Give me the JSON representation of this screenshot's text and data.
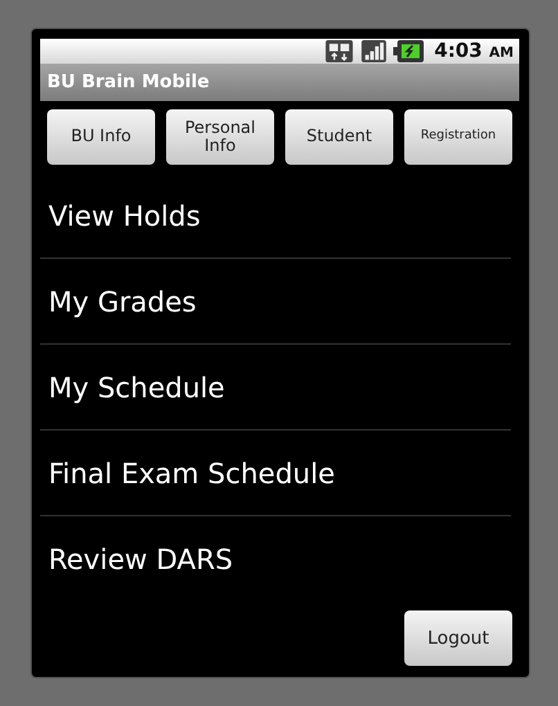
{
  "status_bar": {
    "time": "4:03",
    "period": "AM"
  },
  "window": {
    "title": "BU Brain Mobile"
  },
  "tabs": [
    {
      "label": "BU Info",
      "kind": "normal"
    },
    {
      "label": "Personal Info",
      "kind": "normal"
    },
    {
      "label": "Student",
      "kind": "normal"
    },
    {
      "label": "Registration",
      "kind": "small"
    }
  ],
  "menu": [
    "View Holds",
    "My Grades",
    "My Schedule",
    "Final Exam Schedule",
    "Review DARS"
  ],
  "buttons": [
    "Logout"
  ]
}
